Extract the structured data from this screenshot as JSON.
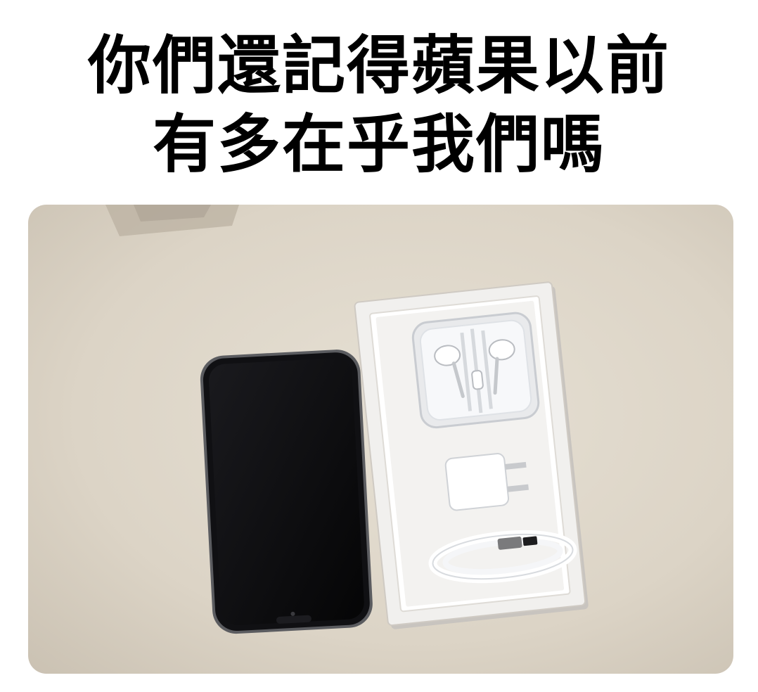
{
  "caption": {
    "line1": "你們還記得蘋果以前",
    "line2": "有多在乎我們嗎"
  },
  "photo": {
    "subject_icons": [
      "smartphone-icon",
      "earpods-case-icon",
      "power-adapter-icon",
      "usb-cable-icon",
      "retail-box-icon"
    ],
    "colors": {
      "table": "#ddd6c9",
      "phone_screen": "#0b0b0d",
      "box_white": "#f1f0ee"
    }
  }
}
